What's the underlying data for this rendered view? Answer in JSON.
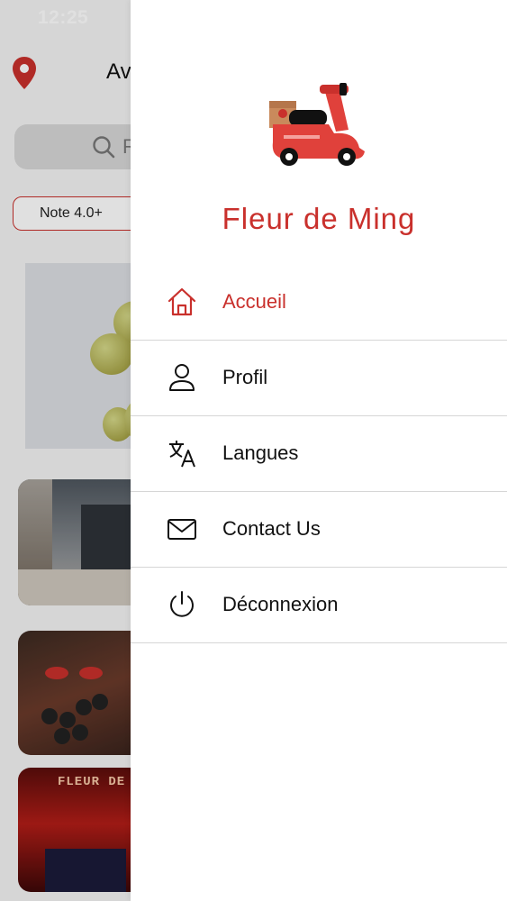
{
  "status_bar": {
    "time": "12:25"
  },
  "background": {
    "address_partial": "Av",
    "search_placeholder_partial": "R",
    "filter_chip": "Note 4.0+"
  },
  "drawer": {
    "brand_name": "Fleur de Ming",
    "menu": [
      {
        "label": "Accueil",
        "icon": "home-icon",
        "active": true
      },
      {
        "label": "Profil",
        "icon": "user-icon",
        "active": false
      },
      {
        "label": "Langues",
        "icon": "translate-icon",
        "active": false
      },
      {
        "label": "Contact Us",
        "icon": "mail-icon",
        "active": false
      },
      {
        "label": "Déconnexion",
        "icon": "power-icon",
        "active": false
      }
    ]
  },
  "restaurant_sign_partial": "FLEUR DE",
  "colors": {
    "accent": "#c9302c",
    "divider": "#d6d6d6"
  }
}
